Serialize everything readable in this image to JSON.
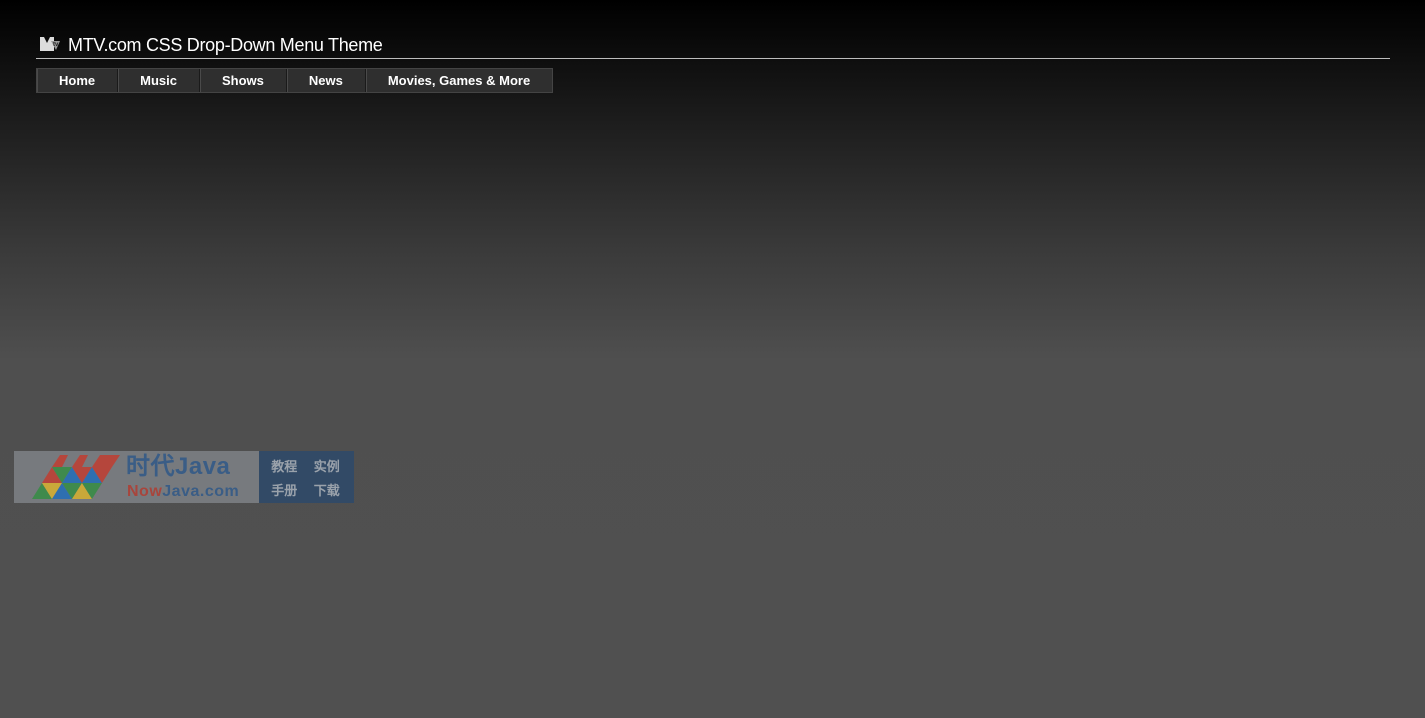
{
  "header": {
    "title": "MTV.com CSS Drop-Down Menu Theme",
    "logo_icon": "mtv-logo-icon"
  },
  "nav": {
    "items": [
      {
        "label": "Home"
      },
      {
        "label": "Music"
      },
      {
        "label": "Shows"
      },
      {
        "label": "News"
      },
      {
        "label": "Movies, Games & More"
      }
    ]
  },
  "watermark": {
    "brand": "时代Java",
    "url_prefix": "Now",
    "url_rest": "Java.com",
    "links": [
      "教程",
      "实例",
      "手册",
      "下载"
    ]
  },
  "colors": {
    "nav_bg": "#2f2f2f",
    "text": "#ffffff",
    "watermark_blue": "#3a5d86",
    "watermark_red": "#a8453c"
  }
}
